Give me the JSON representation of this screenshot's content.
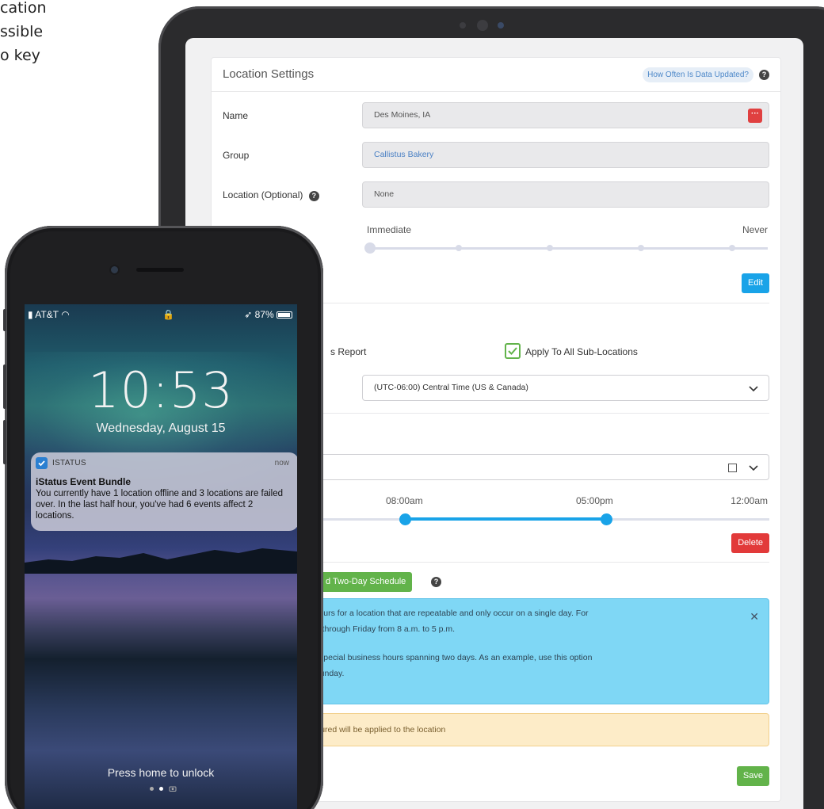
{
  "left_text": [
    "cation",
    "ssible",
    "o key"
  ],
  "settings": {
    "title": "Location Settings",
    "help_link": "How Often Is Data Updated?",
    "name_label": "Name",
    "name_value": "Des Moines, IA",
    "group_label": "Group",
    "group_value": "Callistus Bakery",
    "location_label": "Location (Optional)",
    "location_value": "None",
    "slider_min": "Immediate",
    "slider_max": "Never",
    "slider_level": 0,
    "edit_button": "Edit",
    "report_label_fragment": "s Report",
    "apply_all_label": "Apply To All Sub-Locations",
    "apply_all_checked": true,
    "timezone_value": "(UTC-06:00) Central Time (US & Canada)",
    "time_start": "08:00am",
    "time_end": "05:00pm",
    "time_max": "12:00am",
    "delete_button": "Delete",
    "two_day_button": "d Two-Day Schedule",
    "info_lines": [
      "user set business hours for a location that are repeatable and only occur on a single day. For",
      "ption to set Monday through Friday from 8 a.m. to 5 p.m.",
      "dule lets a user set special business hours spanning two days. As an example, use this option",
      "ay through 2 a.m. Sunday."
    ],
    "warning_text": "isiness hours configured will be applied to the location",
    "save_button": "Save",
    "colors": {
      "primary": "#19a3e8",
      "danger": "#e23a3a",
      "success": "#62b34a",
      "info_bg": "#7fd7f5",
      "warning_bg": "#fdecc8"
    }
  },
  "phone": {
    "carrier": "AT&T",
    "battery": "87%",
    "time": "10:53",
    "date": "Wednesday, August 15",
    "notification": {
      "app": "ISTATUS",
      "when": "now",
      "title": "iStatus Event Bundle",
      "body": "You currently have 1 location offline and 3 locations are failed over. In the last half hour, you've had 6 events affect 2 locations."
    },
    "unlock_hint": "Press home to unlock"
  }
}
